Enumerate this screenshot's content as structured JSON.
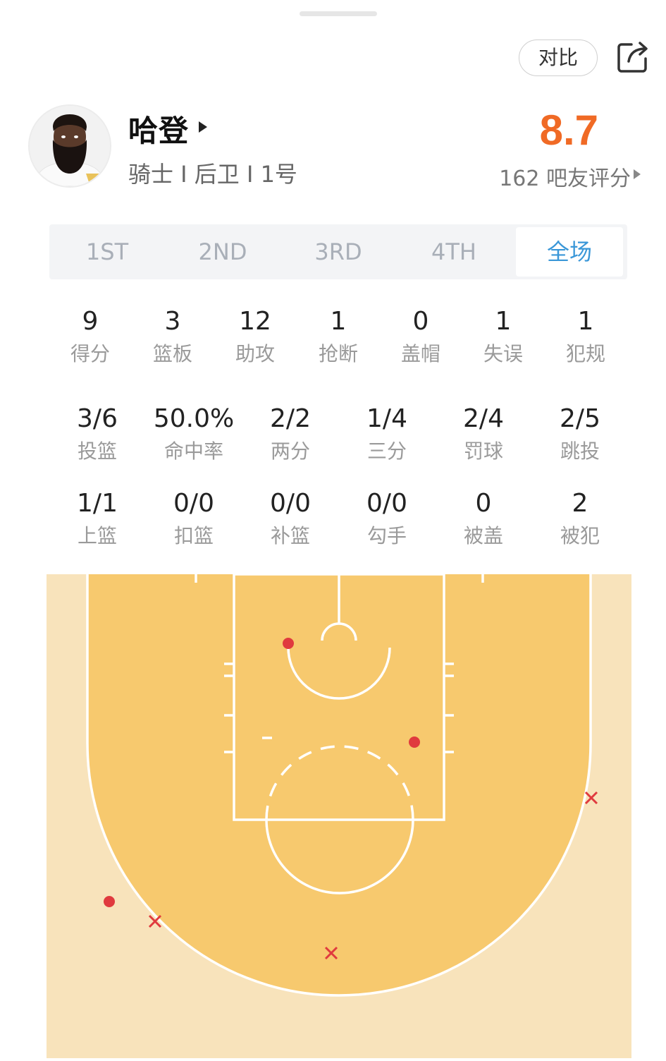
{
  "header": {
    "compare_label": "对比",
    "share_icon": "share-icon"
  },
  "player": {
    "name": "哈登",
    "meta": "骑士 I 后卫 I 1号",
    "rating": "8.7",
    "rating_count": "162 吧友评分"
  },
  "tabs": [
    {
      "label": "1ST",
      "active": false
    },
    {
      "label": "2ND",
      "active": false
    },
    {
      "label": "3RD",
      "active": false
    },
    {
      "label": "4TH",
      "active": false
    },
    {
      "label": "全场",
      "active": true
    }
  ],
  "basic_stats": [
    {
      "value": "9",
      "label": "得分"
    },
    {
      "value": "3",
      "label": "篮板"
    },
    {
      "value": "12",
      "label": "助攻"
    },
    {
      "value": "1",
      "label": "抢断"
    },
    {
      "value": "0",
      "label": "盖帽"
    },
    {
      "value": "1",
      "label": "失误"
    },
    {
      "value": "1",
      "label": "犯规"
    }
  ],
  "shooting_stats": [
    {
      "value": "3/6",
      "label": "投篮"
    },
    {
      "value": "50.0%",
      "label": "命中率"
    },
    {
      "value": "2/2",
      "label": "两分"
    },
    {
      "value": "1/4",
      "label": "三分"
    },
    {
      "value": "2/4",
      "label": "罚球"
    },
    {
      "value": "2/5",
      "label": "跳投"
    }
  ],
  "detail_stats": [
    {
      "value": "1/1",
      "label": "上篮"
    },
    {
      "value": "0/0",
      "label": "扣篮"
    },
    {
      "value": "0/0",
      "label": "补篮"
    },
    {
      "value": "0/0",
      "label": "勾手"
    },
    {
      "value": "0",
      "label": "被盖"
    },
    {
      "value": "2",
      "label": "被犯"
    }
  ],
  "shot_chart": {
    "colors": {
      "made": "#e03a3e",
      "missed": "#e03a3e",
      "inside_arc": "#f7c96e",
      "outside_arc": "#f8e3bb",
      "lines": "#ffffff"
    },
    "legend": {
      "made": "dot",
      "missed": "x"
    }
  }
}
